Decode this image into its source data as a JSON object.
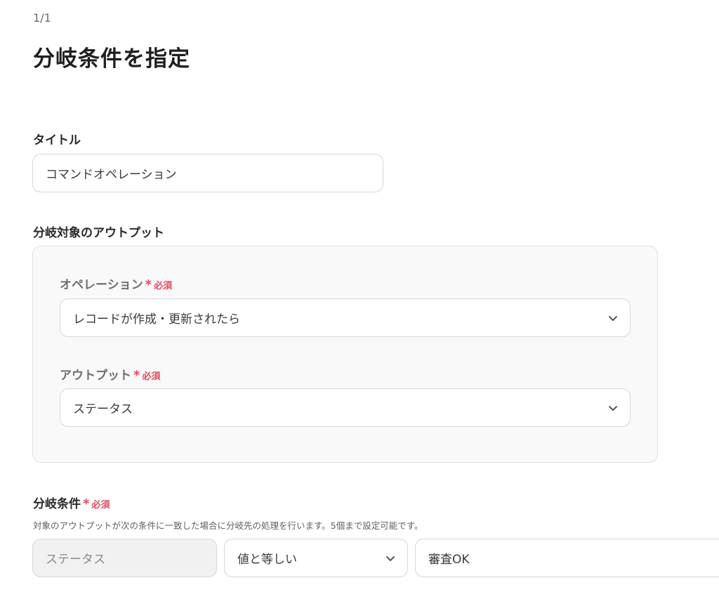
{
  "pager": "1/1",
  "page_title": "分岐条件を指定",
  "title_field": {
    "label": "タイトル",
    "value": "コマンドオペレーション"
  },
  "branch_target": {
    "label": "分岐対象のアウトプット",
    "operation": {
      "label": "オペレーション",
      "required_mark": "*",
      "required_text": "必須",
      "value": "レコードが作成・更新されたら"
    },
    "output": {
      "label": "アウトプット",
      "required_mark": "*",
      "required_text": "必須",
      "value": "ステータス"
    }
  },
  "branch_condition": {
    "label": "分岐条件",
    "required_mark": "*",
    "required_text": "必須",
    "help": "対象のアウトプットが次の条件に一致した場合に分岐先の処理を行います。5個まで設定可能です。",
    "field": "ステータス",
    "operator": "値と等しい",
    "value": "審査OK"
  },
  "icons": {
    "dropdown": "chevron-down-icon"
  }
}
